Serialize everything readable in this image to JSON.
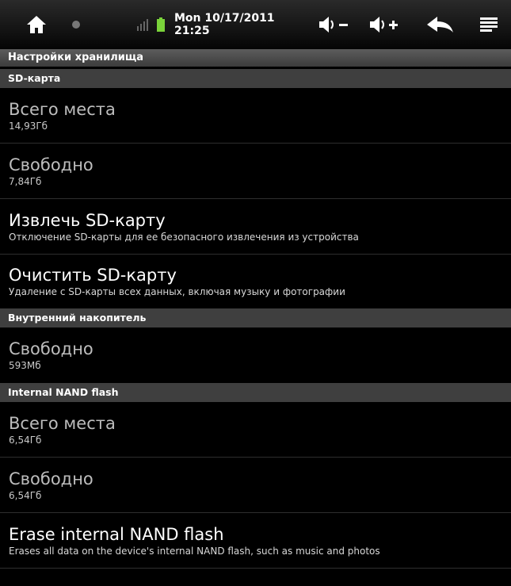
{
  "status_bar": {
    "datetime": "Mon 10/17/2011 21:25",
    "icons": [
      "home-icon",
      "circle-icon",
      "signal-icon",
      "battery-icon",
      "volume-down-icon",
      "volume-up-icon",
      "back-icon",
      "menu-icon"
    ],
    "battery_color": "#7ad33a"
  },
  "title": "Настройки хранилища",
  "sections": {
    "sd": {
      "header": "SD-карта",
      "total_title": "Всего места",
      "total_value": "14,93Гб",
      "free_title": "Свободно",
      "free_value": "7,84Гб",
      "unmount_title": "Извлечь SD-карту",
      "unmount_summary": "Отключение SD-карты для ее безопасного извлечения из устройства",
      "format_title": "Очистить SD-карту",
      "format_summary": "Удаление с SD-карты всех данных, включая музыку и фотографии"
    },
    "internal": {
      "header": "Внутренний накопитель",
      "free_title": "Свободно",
      "free_value": "593Мб"
    },
    "nand": {
      "header": "Internal NAND flash",
      "total_title": "Всего места",
      "total_value": "6,54Гб",
      "free_title": "Свободно",
      "free_value": "6,54Гб",
      "erase_title": "Erase internal NAND flash",
      "erase_summary": "Erases all data on the device's internal NAND flash, such as music and photos"
    }
  }
}
